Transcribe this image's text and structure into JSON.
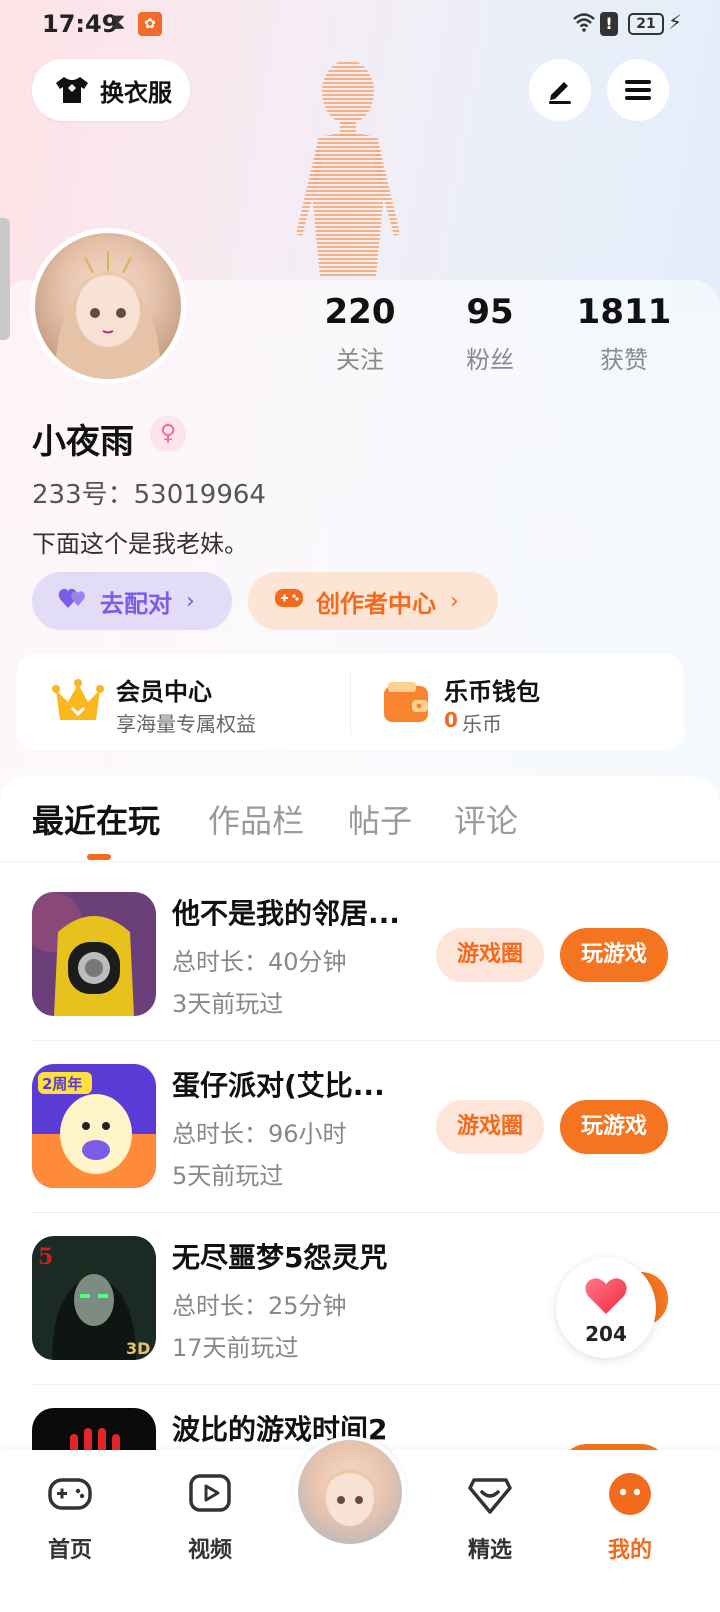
{
  "status_bar": {
    "time": "17:49",
    "battery": "21"
  },
  "header": {
    "dress_label": "换衣服"
  },
  "profile": {
    "name": "小夜雨",
    "gender_symbol": "♀",
    "uid_label": "233号：53019964",
    "bio": "下面这个是我老妹。",
    "stats": [
      {
        "value": "220",
        "label": "关注"
      },
      {
        "value": "95",
        "label": "粉丝"
      },
      {
        "value": "1811",
        "label": "获赞"
      }
    ],
    "match_label": "去配对",
    "creator_label": "创作者中心"
  },
  "cards": {
    "vip_title": "会员中心",
    "vip_sub": "享海量专属权益",
    "wallet_title": "乐币钱包",
    "wallet_amount": "0",
    "wallet_unit": "乐币"
  },
  "tabs": [
    "最近在玩",
    "作品栏",
    "帖子",
    "评论"
  ],
  "games": [
    {
      "name": "他不是我的邻居...",
      "duration": "总时长：40分钟",
      "last_played": "3天前玩过",
      "circle_label": "游戏圈",
      "play_label": "玩游戏"
    },
    {
      "name": "蛋仔派对(艾比...",
      "duration": "总时长：96小时",
      "last_played": "5天前玩过",
      "circle_label": "游戏圈",
      "play_label": "玩游戏"
    },
    {
      "name": "无尽噩梦5怨灵咒",
      "duration": "总时长：25分钟",
      "last_played": "17天前玩过"
    },
    {
      "name": "波比的游戏时间2"
    }
  ],
  "floating": {
    "likes": "204"
  },
  "bottom_nav": [
    {
      "label": "首页"
    },
    {
      "label": "视频"
    },
    {
      "label": "精选"
    },
    {
      "label": "我的"
    }
  ],
  "colors": {
    "accent": "#f26b1d",
    "match": "#7a5ce6"
  }
}
